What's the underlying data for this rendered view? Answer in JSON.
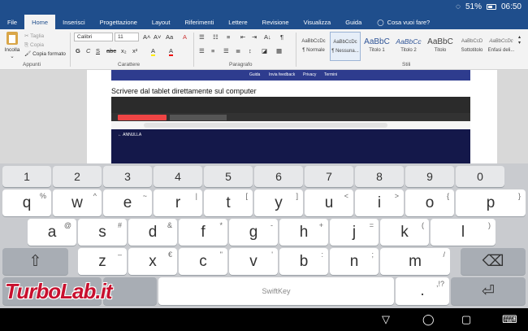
{
  "status_bar": {
    "battery": "51%",
    "time": "06:50"
  },
  "ribbon_tabs": [
    "File",
    "Home",
    "Inserisci",
    "Progettazione",
    "Layout",
    "Riferimenti",
    "Lettere",
    "Revisione",
    "Visualizza",
    "Guida"
  ],
  "tell_me": "Cosa vuoi fare?",
  "clipboard": {
    "paste": "Incolla",
    "cut": "Taglia",
    "copy": "Copia",
    "format_painter": "Copia formato",
    "group": "Appunti"
  },
  "font": {
    "name": "Calibri",
    "size": "11",
    "grow": "A˄",
    "shrink": "A˅",
    "case": "Aa",
    "clear": "A",
    "group": "Carattere"
  },
  "font_tools": [
    "G",
    "C",
    "S",
    "abc",
    "x₂",
    "x²",
    "A",
    "A"
  ],
  "paragraph": {
    "group": "Paragrafo",
    "marks": "¶",
    "sort": "A↓"
  },
  "styles": {
    "items": [
      {
        "sample": "AaBbCcDc",
        "name": "¶ Normale"
      },
      {
        "sample": "AaBbCcDc",
        "name": "¶ Nessuna..."
      },
      {
        "sample": "AaBbC",
        "name": "Titolo 1"
      },
      {
        "sample": "AaBbCc",
        "name": "Titolo 2"
      },
      {
        "sample": "AaBbC",
        "name": "Titolo"
      },
      {
        "sample": "AaBbCcD",
        "name": "Sottotitolo"
      },
      {
        "sample": "AaBbCcDc",
        "name": "Enfasi deli..."
      }
    ],
    "group": "Stili"
  },
  "document": {
    "banner_links": [
      "Guida",
      "Invia feedback",
      "Privacy",
      "Termini"
    ],
    "heading": "Scrivere dal tablet direttamente sul computer",
    "annulla": "ANNULLA"
  },
  "keyboard": {
    "numbers": [
      "1",
      "2",
      "3",
      "4",
      "5",
      "6",
      "7",
      "8",
      "9",
      "0"
    ],
    "row1": [
      {
        "k": "q",
        "a": "%"
      },
      {
        "k": "w",
        "a": "^"
      },
      {
        "k": "e",
        "a": "~"
      },
      {
        "k": "r",
        "a": "|"
      },
      {
        "k": "t",
        "a": "["
      },
      {
        "k": "y",
        "a": "]"
      },
      {
        "k": "u",
        "a": "<"
      },
      {
        "k": "i",
        "a": ">"
      },
      {
        "k": "o",
        "a": "{"
      },
      {
        "k": "p",
        "a": "}"
      }
    ],
    "row2": [
      {
        "k": "a",
        "a": "@"
      },
      {
        "k": "s",
        "a": "#"
      },
      {
        "k": "d",
        "a": "&"
      },
      {
        "k": "f",
        "a": "*"
      },
      {
        "k": "g",
        "a": "-"
      },
      {
        "k": "h",
        "a": "+"
      },
      {
        "k": "j",
        "a": "="
      },
      {
        "k": "k",
        "a": "("
      },
      {
        "k": "l",
        "a": ")"
      }
    ],
    "row3": [
      {
        "k": "z",
        "a": "–"
      },
      {
        "k": "x",
        "a": "€"
      },
      {
        "k": "c",
        "a": "\""
      },
      {
        "k": "v",
        "a": "'"
      },
      {
        "k": "b",
        "a": ":"
      },
      {
        "k": "n",
        "a": ";"
      },
      {
        "k": "m",
        "a": "/"
      }
    ],
    "space_label": "SwiftKey",
    "punct": ".",
    "punct_alt": ",!?",
    "brand_watermark": "TurboLab.it"
  }
}
